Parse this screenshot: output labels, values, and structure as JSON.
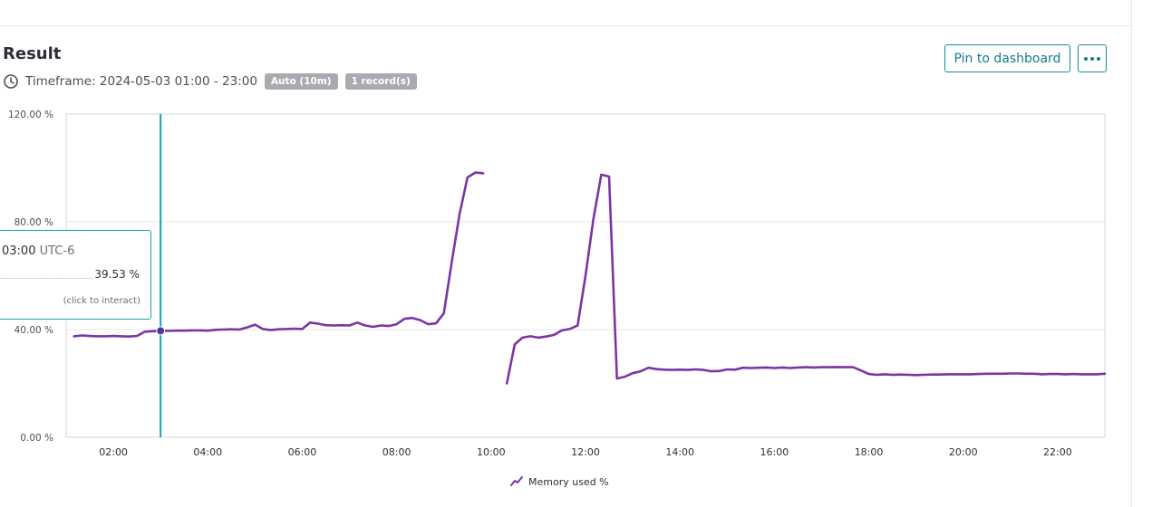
{
  "result": {
    "title": "Result",
    "timeframe_label": "Timeframe: 2024-05-03 01:00 - 23:00",
    "badges": [
      "Auto (10m)",
      "1 record(s)"
    ]
  },
  "toolbar": {
    "pin_label": "Pin to dashboard",
    "more_icon": "more-horizontal-icon"
  },
  "tooltip": {
    "time": "03:00",
    "timezone": "UTC-6",
    "value": "39.53 %",
    "hint": "(click to interact)"
  },
  "legend": {
    "label": "Memory used %"
  },
  "colors": {
    "series": "#7b35a3",
    "cursor": "#1aa0b0",
    "accent": "#107b8c"
  },
  "chart_data": {
    "type": "line",
    "xlabel": "",
    "ylabel": "",
    "ylim": [
      0,
      120
    ],
    "xlim": [
      "01:00",
      "23:00"
    ],
    "y_ticks": [
      "0.00 %",
      "40.00 %",
      "80.00 %",
      "120.00 %"
    ],
    "x_ticks": [
      "02:00",
      "04:00",
      "06:00",
      "08:00",
      "10:00",
      "12:00",
      "14:00",
      "16:00",
      "18:00",
      "20:00",
      "22:00"
    ],
    "grid": "horizontal",
    "legend_position": "bottom-center",
    "cursor_x": "03:00",
    "series": [
      {
        "name": "Memory used %",
        "points": [
          [
            "01:10",
            37.5
          ],
          [
            "01:20",
            37.8
          ],
          [
            "01:30",
            37.6
          ],
          [
            "01:40",
            37.5
          ],
          [
            "01:50",
            37.5
          ],
          [
            "02:00",
            37.6
          ],
          [
            "02:10",
            37.5
          ],
          [
            "02:20",
            37.4
          ],
          [
            "02:30",
            37.6
          ],
          [
            "02:40",
            39.2
          ],
          [
            "02:50",
            39.4
          ],
          [
            "03:00",
            39.53
          ],
          [
            "03:10",
            39.5
          ],
          [
            "03:20",
            39.6
          ],
          [
            "03:30",
            39.6
          ],
          [
            "03:40",
            39.7
          ],
          [
            "03:50",
            39.7
          ],
          [
            "04:00",
            39.6
          ],
          [
            "04:10",
            39.9
          ],
          [
            "04:20",
            40.0
          ],
          [
            "04:30",
            40.1
          ],
          [
            "04:40",
            40.0
          ],
          [
            "04:50",
            40.8
          ],
          [
            "05:00",
            41.8
          ],
          [
            "05:10",
            40.2
          ],
          [
            "05:20",
            39.8
          ],
          [
            "05:30",
            40.1
          ],
          [
            "05:40",
            40.2
          ],
          [
            "05:50",
            40.3
          ],
          [
            "06:00",
            40.2
          ],
          [
            "06:10",
            42.6
          ],
          [
            "06:20",
            42.2
          ],
          [
            "06:30",
            41.6
          ],
          [
            "06:40",
            41.5
          ],
          [
            "06:50",
            41.6
          ],
          [
            "07:00",
            41.5
          ],
          [
            "07:10",
            42.6
          ],
          [
            "07:20",
            41.5
          ],
          [
            "07:30",
            41.0
          ],
          [
            "07:40",
            41.5
          ],
          [
            "07:50",
            41.3
          ],
          [
            "08:00",
            42.0
          ],
          [
            "08:10",
            44.0
          ],
          [
            "08:20",
            44.3
          ],
          [
            "08:30",
            43.5
          ],
          [
            "08:40",
            42.0
          ],
          [
            "08:50",
            42.3
          ],
          [
            "09:00",
            46.0
          ],
          [
            "09:10",
            65.0
          ],
          [
            "09:20",
            83.0
          ],
          [
            "09:30",
            96.5
          ],
          [
            "09:40",
            98.3
          ],
          [
            "09:50",
            98.0
          ],
          null,
          [
            "10:20",
            20.0
          ],
          [
            "10:30",
            34.5
          ],
          [
            "10:40",
            37.0
          ],
          [
            "10:50",
            37.5
          ],
          [
            "11:00",
            37.0
          ],
          [
            "11:10",
            37.4
          ],
          [
            "11:20",
            38.0
          ],
          [
            "11:30",
            39.7
          ],
          [
            "11:40",
            40.2
          ],
          [
            "11:50",
            41.5
          ],
          [
            "12:00",
            60.0
          ],
          [
            "12:10",
            81.0
          ],
          [
            "12:20",
            97.5
          ],
          [
            "12:30",
            96.8
          ],
          [
            "12:40",
            21.8
          ],
          [
            "12:50",
            22.5
          ],
          [
            "13:00",
            23.8
          ],
          [
            "13:10",
            24.5
          ],
          [
            "13:20",
            25.8
          ],
          [
            "13:30",
            25.3
          ],
          [
            "13:40",
            25.1
          ],
          [
            "13:50",
            25.0
          ],
          [
            "14:00",
            25.1
          ],
          [
            "14:10",
            25.0
          ],
          [
            "14:20",
            25.2
          ],
          [
            "14:30",
            25.0
          ],
          [
            "14:40",
            24.5
          ],
          [
            "14:50",
            24.6
          ],
          [
            "15:00",
            25.2
          ],
          [
            "15:10",
            25.1
          ],
          [
            "15:20",
            25.8
          ],
          [
            "15:30",
            25.7
          ],
          [
            "15:40",
            25.8
          ],
          [
            "15:50",
            25.9
          ],
          [
            "16:00",
            25.7
          ],
          [
            "16:10",
            25.9
          ],
          [
            "16:20",
            25.7
          ],
          [
            "16:30",
            25.9
          ],
          [
            "16:40",
            26.0
          ],
          [
            "16:50",
            25.9
          ],
          [
            "17:00",
            26.0
          ],
          [
            "17:10",
            26.0
          ],
          [
            "17:20",
            26.1
          ],
          [
            "17:30",
            26.0
          ],
          [
            "17:40",
            26.0
          ],
          [
            "17:50",
            24.8
          ],
          [
            "18:00",
            23.5
          ],
          [
            "18:10",
            23.2
          ],
          [
            "18:20",
            23.4
          ],
          [
            "18:30",
            23.2
          ],
          [
            "18:40",
            23.3
          ],
          [
            "18:50",
            23.2
          ],
          [
            "19:00",
            23.1
          ],
          [
            "19:10",
            23.2
          ],
          [
            "19:20",
            23.3
          ],
          [
            "19:30",
            23.3
          ],
          [
            "19:40",
            23.4
          ],
          [
            "19:50",
            23.4
          ],
          [
            "20:00",
            23.4
          ],
          [
            "20:10",
            23.4
          ],
          [
            "20:20",
            23.5
          ],
          [
            "20:30",
            23.6
          ],
          [
            "20:40",
            23.6
          ],
          [
            "20:50",
            23.6
          ],
          [
            "21:00",
            23.7
          ],
          [
            "21:10",
            23.7
          ],
          [
            "21:20",
            23.6
          ],
          [
            "21:30",
            23.6
          ],
          [
            "21:40",
            23.4
          ],
          [
            "21:50",
            23.5
          ],
          [
            "22:00",
            23.5
          ],
          [
            "22:10",
            23.4
          ],
          [
            "22:20",
            23.5
          ],
          [
            "22:30",
            23.4
          ],
          [
            "22:40",
            23.4
          ],
          [
            "22:50",
            23.4
          ],
          [
            "23:00",
            23.6
          ]
        ]
      }
    ]
  }
}
